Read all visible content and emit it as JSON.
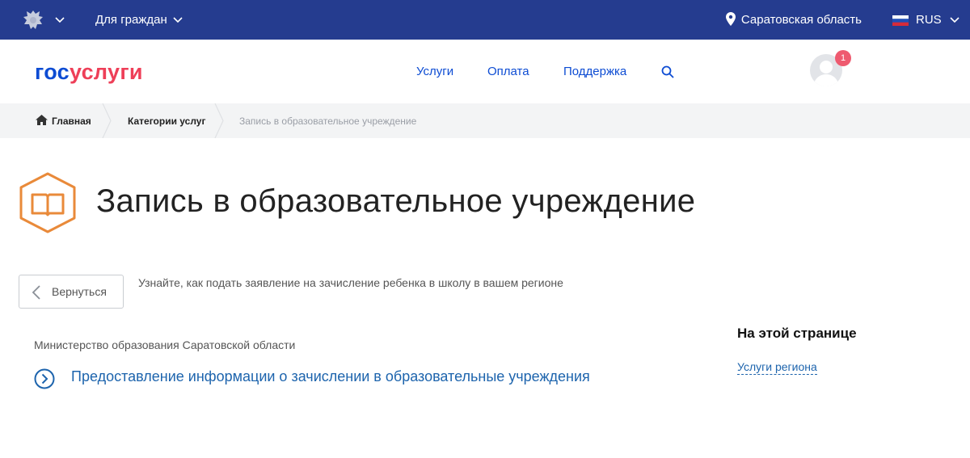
{
  "topbar": {
    "emblem_icon": "coat-of-arms-icon",
    "audience_label": "Для граждан",
    "region_label": "Саратовская область",
    "language_label": "RUS",
    "background_color": "#253c8f"
  },
  "header": {
    "logo_part1": "гос",
    "logo_part2": "услуги",
    "nav": [
      "Услуги",
      "Оплата",
      "Поддержка"
    ],
    "notification_count": "1",
    "brand_blue": "#0d4cd3",
    "brand_red": "#ee3f58"
  },
  "breadcrumbs": {
    "home": "Главная",
    "categories": "Категории услуг",
    "current": "Запись в образовательное учреждение"
  },
  "page": {
    "title": "Запись в образовательное учреждение",
    "title_icon": "book-icon",
    "accent_color": "#e98a3a",
    "back_label": "Вернуться",
    "lead": "Узнайте, как подать заявление на зачисление ребенка в школу в вашем регионе",
    "ministry": "Министерство образования Саратовской области",
    "service_link": "Предоставление информации о зачислении в образовательные учреждения"
  },
  "aside": {
    "title": "На этой странице",
    "link": "Услуги региона"
  }
}
